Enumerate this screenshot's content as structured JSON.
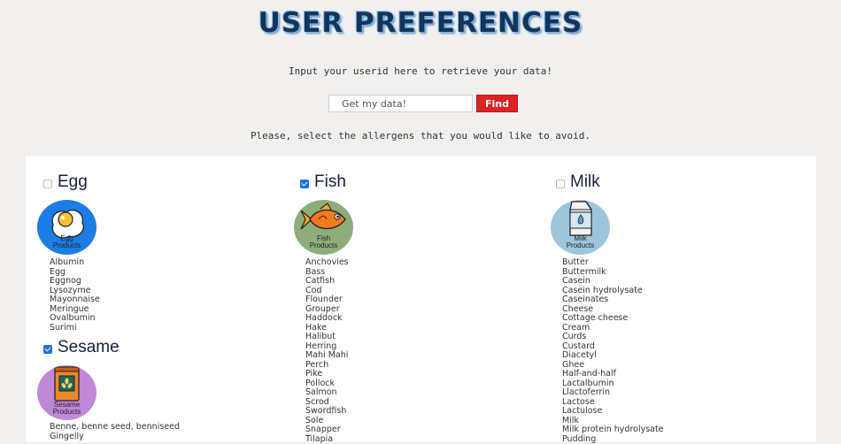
{
  "page": {
    "title": "USER PREFERENCES",
    "intro": "Input your userid here to retrieve your data!",
    "search_placeholder": "Get my data!",
    "find_label": "Find",
    "allergen_prompt": "Please, select the allergens that you would like to avoid."
  },
  "colors": {
    "background": "#f1f0ee",
    "find_button": "#dc2222",
    "title": "#13355c",
    "egg_circle": "#1b7de5",
    "fish_circle": "#8ead7a",
    "milk_circle": "#9dc6dd",
    "sesame_circle": "#c088d6"
  },
  "categories": [
    {
      "name": "Egg",
      "checked": false,
      "icon": "fried-egg-icon",
      "icon_label": [
        "Egg",
        "Products"
      ],
      "items": [
        "Albumin",
        "Egg",
        "Eggnog",
        "Lysozyme",
        "Mayonnaise",
        "Meringue",
        "Ovalbumin",
        "Surimi"
      ]
    },
    {
      "name": "Fish",
      "checked": true,
      "icon": "fish-icon",
      "icon_label": [
        "Fish",
        "Products"
      ],
      "items": [
        "Anchovies",
        "Bass",
        "Catfish",
        "Cod",
        "Flounder",
        "Grouper",
        "Haddock",
        "Hake",
        "Halibut",
        "Herring",
        "Mahi Mahi",
        "Perch",
        "Pike",
        "Pollock",
        "Salmon",
        "Scrod",
        "Swordfish",
        "Sole",
        "Snapper",
        "Tilapia"
      ]
    },
    {
      "name": "Milk",
      "checked": false,
      "icon": "milk-carton-icon",
      "icon_label": [
        "Milk",
        "Products"
      ],
      "items": [
        "Butter",
        "Buttermilk",
        "Casein",
        "Casein hydrolysate",
        "Caseinates",
        "Cheese",
        "Cottage cheese",
        "Cream",
        "Curds",
        "Custard",
        "Diacetyl",
        "Ghee",
        "Half-and-half",
        "Lactalbumin",
        "Llactoferrin",
        "Lactose",
        "Lactulose",
        "Milk",
        "Milk protein hydrolysate",
        "Pudding"
      ]
    },
    {
      "name": "Sesame",
      "checked": true,
      "icon": "sesame-bag-icon",
      "icon_label": [
        "Sesame",
        "Products"
      ],
      "items": [
        "Benne, benne seed, benniseed",
        "Gingelly"
      ]
    }
  ]
}
